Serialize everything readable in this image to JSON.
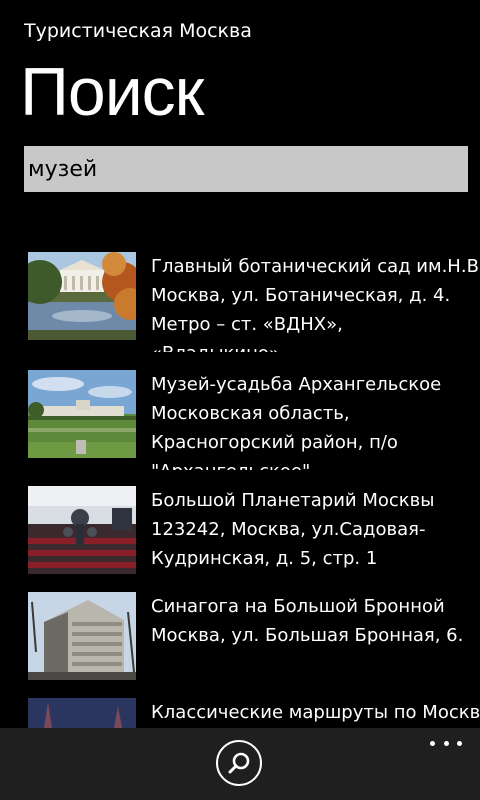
{
  "app": {
    "title": "Туристическая Москва"
  },
  "page": {
    "title": "Поиск"
  },
  "search": {
    "value": "музей"
  },
  "results": [
    {
      "title": "Главный ботанический сад им.Н.В.",
      "address": "Москва, ул. Ботаническая,  д. 4.\nМетро – ст. «ВДНХ», «Владыкино».",
      "thumbnail": "botanical-garden-photo"
    },
    {
      "title": "Музей-усадьба Архангельское",
      "address": "Московская область,\nКрасногорский район, п/о\n\"Архангельское\"",
      "thumbnail": "arkhangelskoye-estate-photo"
    },
    {
      "title": "Большой Планетарий Москвы",
      "address": "123242, Москва, ул.Садовая-\nКудринская, д. 5, стр. 1",
      "thumbnail": "planetarium-photo"
    },
    {
      "title": "Синагога на Большой Бронной",
      "address": "Москва, ул. Большая Бронная, 6.",
      "thumbnail": "synagogue-photo"
    },
    {
      "title": "Классические маршруты по Москве",
      "address": "",
      "thumbnail": "moscow-night-photo"
    }
  ],
  "app_bar": {
    "icons": [
      "search-icon",
      "more-options-icon"
    ],
    "background": "#1f1f1f"
  }
}
